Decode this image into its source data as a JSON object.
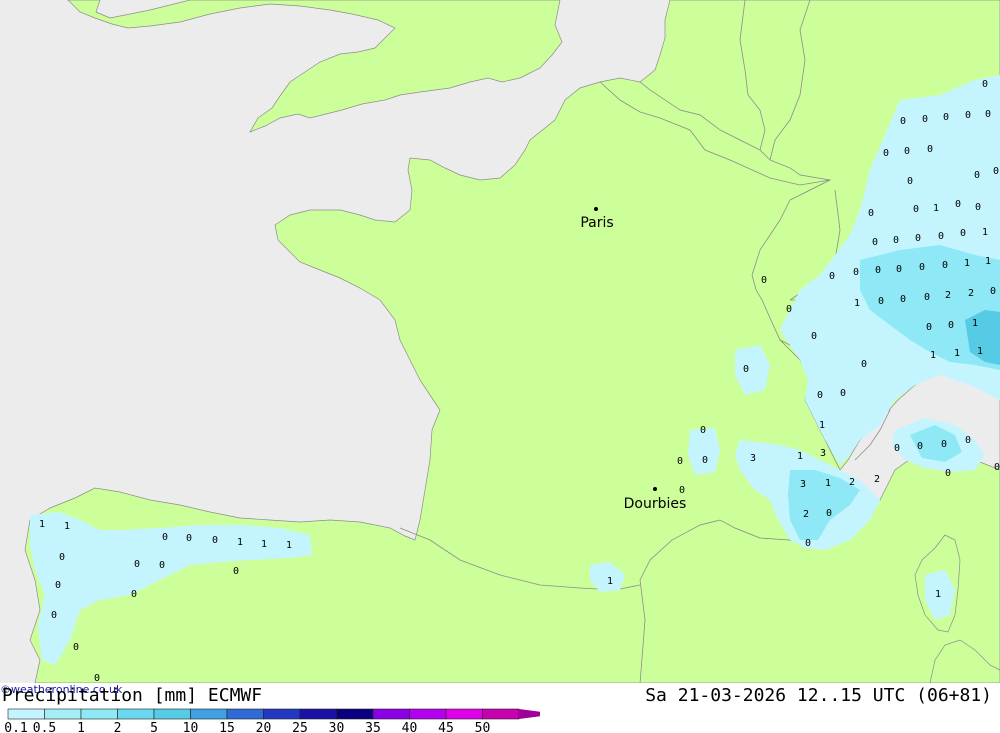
{
  "title": {
    "left": "Precipitation [mm] ECMWF",
    "right": "Sa 21-03-2026 12..15 UTC (06+81)"
  },
  "credit": "©weatheronline.co.uk",
  "colors": {
    "sea": "#ececec",
    "land": "#ccff99",
    "border": "#8c8c8c",
    "precip_light": "#c4f5ff",
    "precip_mid": "#8ee8f5",
    "precip_heavy": "#55cbe6"
  },
  "legend": {
    "labels": [
      "0.1",
      "0.5",
      "1",
      "2",
      "5",
      "10",
      "15",
      "20",
      "25",
      "30",
      "35",
      "40",
      "45",
      "50"
    ],
    "colors": [
      "#c4f5ff",
      "#a5eef7",
      "#8ee8f5",
      "#6ad8ef",
      "#55cbe6",
      "#3fa0e2",
      "#2f6ad6",
      "#2238c2",
      "#1a12a6",
      "#0a0080",
      "#8c00e6",
      "#b400f0",
      "#e000ea",
      "#c800b0",
      "#a0009a"
    ]
  },
  "cities": [
    {
      "name": "Paris"
    },
    {
      "name": "Dourbies"
    }
  ],
  "values": [
    "0",
    "0",
    "0",
    "0",
    "0",
    "0",
    "0",
    "0",
    "0",
    "0",
    "0",
    "0",
    "0",
    "0",
    "1",
    "0",
    "0",
    "0",
    "0",
    "0",
    "0",
    "0",
    "1",
    "0",
    "0",
    "0",
    "0",
    "0",
    "0",
    "0",
    "1",
    "1",
    "0",
    "1",
    "0",
    "0",
    "0",
    "2",
    "2",
    "0",
    "0",
    "0",
    "0",
    "1",
    "1",
    "1",
    "1",
    "0",
    "0",
    "0",
    "0",
    "1",
    "0",
    "0",
    "0",
    "3",
    "3",
    "1",
    "0",
    "0",
    "0",
    "0",
    "0",
    "0",
    "0",
    "3",
    "1",
    "2",
    "2",
    "2",
    "0",
    "0",
    "1",
    "1",
    "0",
    "0",
    "0",
    "1",
    "1",
    "1",
    "0",
    "0",
    "0",
    "0",
    "0",
    "0",
    "0",
    "0",
    "1",
    "1",
    "0",
    "0"
  ]
}
